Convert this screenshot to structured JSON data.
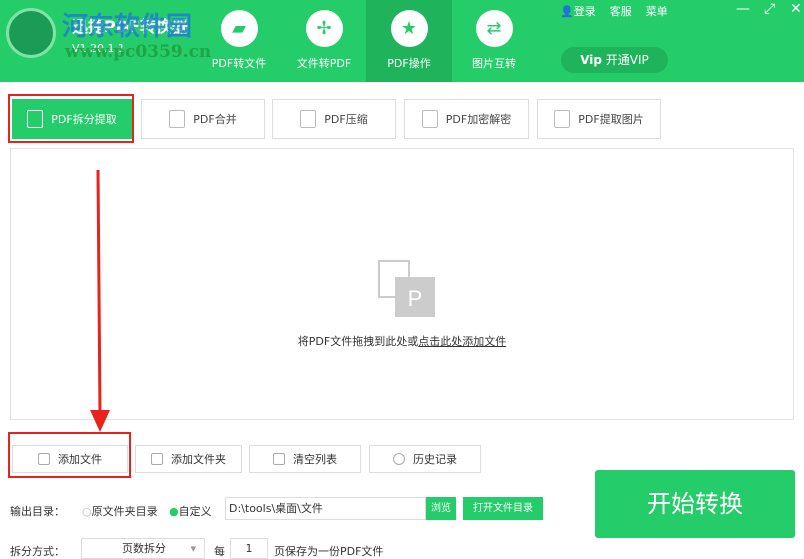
{
  "app": {
    "title": "迅捷PDF转换器",
    "version": "V1.20.1.1",
    "watermark_name": "河东软件园",
    "watermark_url": "www.pc0359.cn"
  },
  "nav": [
    {
      "label": "PDF转文件",
      "icon": "folder-icon"
    },
    {
      "label": "文件转PDF",
      "icon": "acrobat-icon"
    },
    {
      "label": "PDF操作",
      "icon": "star-icon"
    },
    {
      "label": "图片互转",
      "icon": "swap-icon"
    }
  ],
  "toplinks": {
    "login": "登录",
    "service": "客服",
    "menu": "菜单"
  },
  "vip": {
    "label": "开通VIP",
    "badge": "Vip"
  },
  "tabs": [
    {
      "label": "PDF拆分提取"
    },
    {
      "label": "PDF合并"
    },
    {
      "label": "PDF压缩"
    },
    {
      "label": "PDF加密解密"
    },
    {
      "label": "PDF提取图片"
    }
  ],
  "drop": {
    "text": "将PDF文件拖拽到此处或",
    "link": "点击此处添加文件",
    "icon_letter": "P"
  },
  "buttons": {
    "add_file": "添加文件",
    "add_folder": "添加文件夹",
    "clear": "清空列表",
    "history": "历史记录",
    "start": "开始转换"
  },
  "output": {
    "label": "输出目录：",
    "opt_original": "原文件夹目录",
    "opt_custom": "自定义",
    "path": "D:\\tools\\桌面\\文件",
    "browse": "浏览",
    "open_dir": "打开文件目录"
  },
  "split": {
    "label": "拆分方式：",
    "mode": "页数拆分",
    "every": "每",
    "pages": "1",
    "suffix": "页保存为一份PDF文件"
  }
}
